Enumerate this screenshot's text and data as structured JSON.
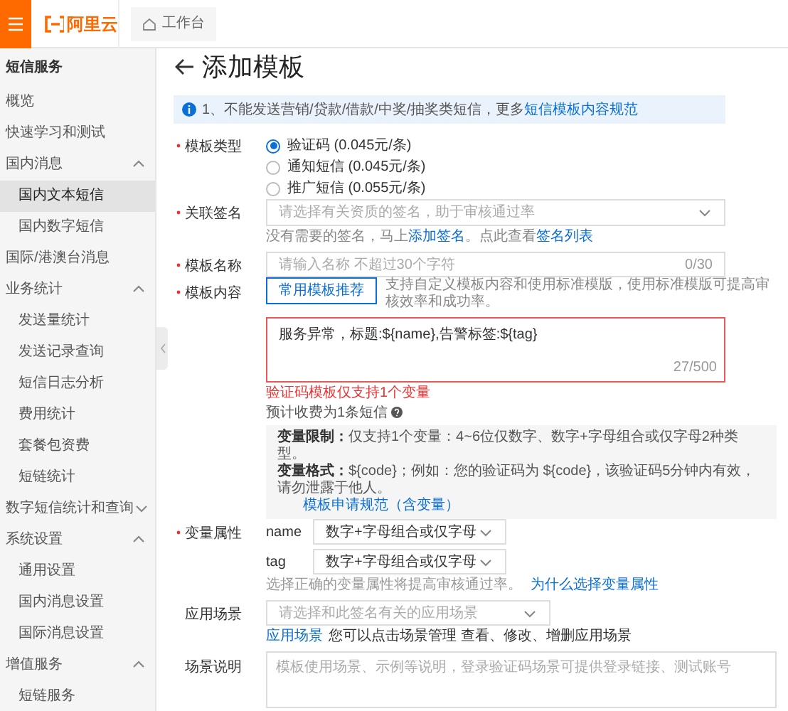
{
  "header": {
    "logo_text": "阿里云",
    "workbench_tab": "工作台"
  },
  "sidebar": {
    "title": "短信服务",
    "items": [
      {
        "label": "概览",
        "selected": false
      },
      {
        "label": "快速学习和测试",
        "selected": false
      },
      {
        "label": "国内消息",
        "selected": false,
        "expanded": true,
        "children": [
          {
            "label": "国内文本短信",
            "selected": true
          },
          {
            "label": "国内数字短信",
            "selected": false
          }
        ]
      },
      {
        "label": "国际/港澳台消息",
        "selected": false
      },
      {
        "label": "业务统计",
        "selected": false,
        "expanded": true,
        "children": [
          {
            "label": "发送量统计",
            "selected": false
          },
          {
            "label": "发送记录查询",
            "selected": false
          },
          {
            "label": "短信日志分析",
            "selected": false
          },
          {
            "label": "费用统计",
            "selected": false
          },
          {
            "label": "套餐包资费",
            "selected": false
          },
          {
            "label": "短链统计",
            "selected": false
          }
        ]
      },
      {
        "label": "数字短信统计和查询",
        "selected": false,
        "expanded": false
      },
      {
        "label": "系统设置",
        "selected": false,
        "expanded": true,
        "children": [
          {
            "label": "通用设置",
            "selected": false
          },
          {
            "label": "国内消息设置",
            "selected": false
          },
          {
            "label": "国际消息设置",
            "selected": false
          }
        ]
      },
      {
        "label": "增值服务",
        "selected": false,
        "expanded": true,
        "children": [
          {
            "label": "短链服务",
            "selected": false
          }
        ]
      }
    ]
  },
  "page_title": "添加模板",
  "notice": {
    "text": "1、不能发送营销/贷款/借款/中奖/抽奖类短信，更多",
    "link": "短信模板内容规范"
  },
  "template_type": {
    "label": "模板类型",
    "required": true,
    "options": [
      {
        "label": "验证码 (0.045元/条)",
        "selected": true
      },
      {
        "label": "通知短信 (0.045元/条)",
        "selected": false
      },
      {
        "label": "推广短信 (0.055元/条)",
        "selected": false
      }
    ]
  },
  "signature": {
    "label": "关联签名",
    "required": true,
    "placeholder": "请选择有关资质的签名，助于审核通过率",
    "hint": [
      {
        "kind": "text",
        "text": "没有需要的签名，马上"
      },
      {
        "kind": "link",
        "text": "添加签名"
      },
      {
        "kind": "text",
        "text": "。点此查看"
      },
      {
        "kind": "link",
        "text": "签名列表"
      }
    ]
  },
  "template_name": {
    "label": "模板名称",
    "required": true,
    "placeholder": "请输入名称 不超过30个字符",
    "counter": "0/30"
  },
  "template_content": {
    "label": "模板内容",
    "required": true,
    "recommend_button": "常用模板推荐",
    "description": "支持自定义模板内容和使用标准模版，使用标准模版可提高审核效率和成功率。",
    "value": "服务异常，标题:${name},告警标签:${tag}",
    "counter": "27/500",
    "error": "验证码模板仅支持1个变量",
    "fee_note": "预计收费为1条短信",
    "rules": [
      {
        "title": "变量限制：",
        "text": "仅支持1个变量：4~6位仅数字、数字+字母组合或仅字母2种类型。"
      },
      {
        "title": "变量格式：",
        "text": "${code}；例如：您的验证码为 ${code}，该验证码5分钟内有效，请勿泄露于他人。"
      }
    ],
    "rules_link": "模板申请规范（含变量）"
  },
  "variables": {
    "label": "变量属性",
    "required": true,
    "items": [
      {
        "name": "name",
        "value": "数字+字母组合或仅字母"
      },
      {
        "name": "tag",
        "value": "数字+字母组合或仅字母"
      }
    ],
    "hint": "选择正确的变量属性将提高审核通过率。",
    "hint_link": "为什么选择变量属性"
  },
  "scene": {
    "label": "应用场景",
    "required": false,
    "placeholder": "请选择和此签名有关的应用场景",
    "hint_link": "应用场景",
    "hint": "您可以点击场景管理 查看、修改、增删应用场景"
  },
  "scene_description": {
    "label": "场景说明",
    "required": false,
    "placeholder": "模板使用场景、示例等说明，登录验证码场景可提供登录链接、测试账号"
  }
}
